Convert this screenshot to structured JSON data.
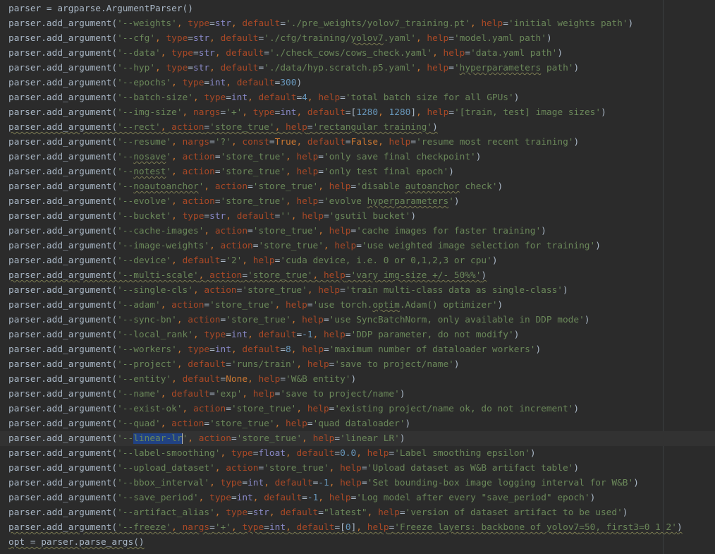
{
  "editor": {
    "language": "python",
    "current_line": 29,
    "colors": {
      "background": "#2b2b2b",
      "text": "#a9b7c6",
      "keyword": "#cc7832",
      "string": "#6a8759",
      "number": "#6897bb",
      "param": "#aa4926",
      "selection": "#214283"
    },
    "lines": [
      "parser = argparse.ArgumentParser()",
      "parser.add_argument('--weights', type=str, default='./pre_weights/yolov7_training.pt', help='initial weights path')",
      "parser.add_argument('--cfg', type=str, default='./cfg/training/yolov7.yaml', help='model.yaml path')",
      "parser.add_argument('--data', type=str, default='./check_cows/cows_check.yaml', help='data.yaml path')",
      "parser.add_argument('--hyp', type=str, default='./data/hyp.scratch.p5.yaml', help='hyperparameters path')",
      "parser.add_argument('--epochs', type=int, default=300)",
      "parser.add_argument('--batch-size', type=int, default=4, help='total batch size for all GPUs')",
      "parser.add_argument('--img-size', nargs='+', type=int, default=[1280, 1280], help='[train, test] image sizes')",
      "parser.add_argument('--rect', action='store_true', help='rectangular training')",
      "parser.add_argument('--resume', nargs='?', const=True, default=False, help='resume most recent training')",
      "parser.add_argument('--nosave', action='store_true', help='only save final checkpoint')",
      "parser.add_argument('--notest', action='store_true', help='only test final epoch')",
      "parser.add_argument('--noautoanchor', action='store_true', help='disable autoanchor check')",
      "parser.add_argument('--evolve', action='store_true', help='evolve hyperparameters')",
      "parser.add_argument('--bucket', type=str, default='', help='gsutil bucket')",
      "parser.add_argument('--cache-images', action='store_true', help='cache images for faster training')",
      "parser.add_argument('--image-weights', action='store_true', help='use weighted image selection for training')",
      "parser.add_argument('--device', default='2', help='cuda device, i.e. 0 or 0,1,2,3 or cpu')",
      "parser.add_argument('--multi-scale', action='store_true', help='vary img-size +/- 50%%')",
      "parser.add_argument('--single-cls', action='store_true', help='train multi-class data as single-class')",
      "parser.add_argument('--adam', action='store_true', help='use torch.optim.Adam() optimizer')",
      "parser.add_argument('--sync-bn', action='store_true', help='use SyncBatchNorm, only available in DDP mode')",
      "parser.add_argument('--local_rank', type=int, default=-1, help='DDP parameter, do not modify')",
      "parser.add_argument('--workers', type=int, default=8, help='maximum number of dataloader workers')",
      "parser.add_argument('--project', default='runs/train', help='save to project/name')",
      "parser.add_argument('--entity', default=None, help='W&B entity')",
      "parser.add_argument('--name', default='exp', help='save to project/name')",
      "parser.add_argument('--exist-ok', action='store_true', help='existing project/name ok, do not increment')",
      "parser.add_argument('--quad', action='store_true', help='quad dataloader')",
      "parser.add_argument('--linear-lr', action='store_true', help='linear LR')",
      "parser.add_argument('--label-smoothing', type=float, default=0.0, help='Label smoothing epsilon')",
      "parser.add_argument('--upload_dataset', action='store_true', help='Upload dataset as W&B artifact table')",
      "parser.add_argument('--bbox_interval', type=int, default=-1, help='Set bounding-box image logging interval for W&B')",
      "parser.add_argument('--save_period', type=int, default=-1, help='Log model after every \"save_period\" epoch')",
      "parser.add_argument('--artifact_alias', type=str, default=\"latest\", help='version of dataset artifact to be used')",
      "parser.add_argument('--freeze', nargs='+', type=int, default=[0], help='Freeze layers: backbone of yolov7=50, first3=0 1 2')",
      "opt = parser.parse_args()"
    ],
    "underlined_words": [
      "yolov7",
      "hyperparameters",
      "nosave",
      "notest",
      "noautoanchor",
      "autoanchor",
      "optim"
    ],
    "underlined_lines": [
      8,
      18,
      35,
      36
    ],
    "selection": {
      "line": 29,
      "text": "linear-lr"
    }
  }
}
